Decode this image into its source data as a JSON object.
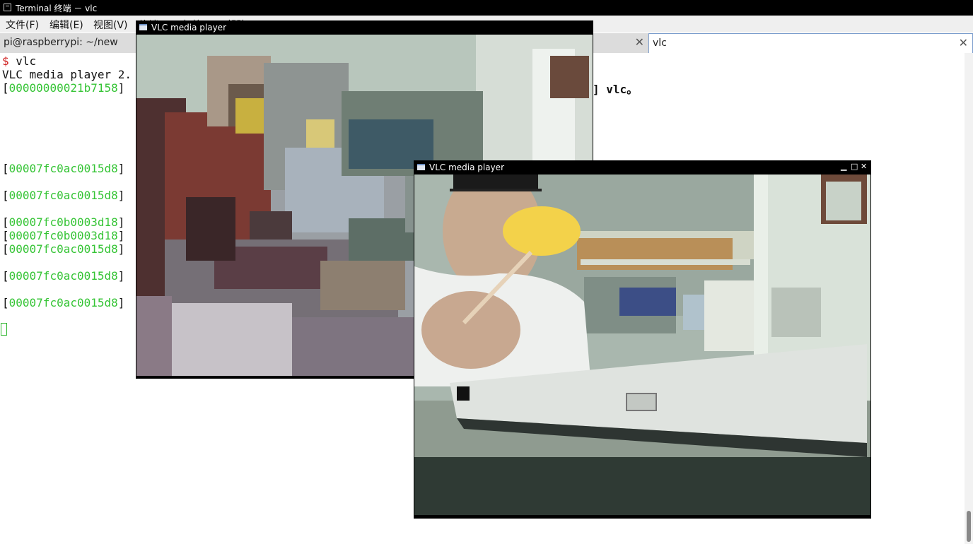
{
  "window": {
    "title": "Terminal 终端 － vlc"
  },
  "menu": [
    "文件(F)",
    "编辑(E)",
    "视图(V)",
    "终端(T)",
    "标签(A)",
    "帮助(H)"
  ],
  "tabs": [
    {
      "label": "pi@raspberrypi: ~/new",
      "close": "✕",
      "active": false
    },
    {
      "label": "vlc",
      "close": "✕",
      "active": true
    }
  ],
  "terminal": {
    "prompt_symbol": "$",
    "command": " vlc",
    "version_line": "VLC media player 2.",
    "lines": [
      {
        "open": "[",
        "addr": "00000000021b7158",
        "close": "]"
      },
      {
        "open": "[",
        "addr": "00007fc0ac0015d8",
        "close": "]"
      },
      {
        "open": "[",
        "addr": "00007fc0ac0015d8",
        "close": "]"
      },
      {
        "open": "[",
        "addr": "00007fc0b0003d18",
        "close": "]"
      },
      {
        "open": "[",
        "addr": "00007fc0b0003d18",
        "close": "]"
      },
      {
        "open": "[",
        "addr": "00007fc0ac0015d8",
        "close": "]"
      },
      {
        "open": "[",
        "addr": "00007fc0ac0015d8",
        "close": "]"
      },
      {
        "open": "[",
        "addr": "00007fc0ac0015d8",
        "close": "]"
      }
    ],
    "right_text": "] vlc。"
  },
  "vlc_windows": [
    {
      "title": "VLC media player"
    },
    {
      "title": "VLC media player",
      "controls": {
        "minimize": "▁",
        "maximize": "□",
        "close": "✕"
      }
    }
  ],
  "colors": {
    "address_green": "#35c435",
    "prompt_red": "#d02020",
    "titlebar_bg": "#000000"
  }
}
